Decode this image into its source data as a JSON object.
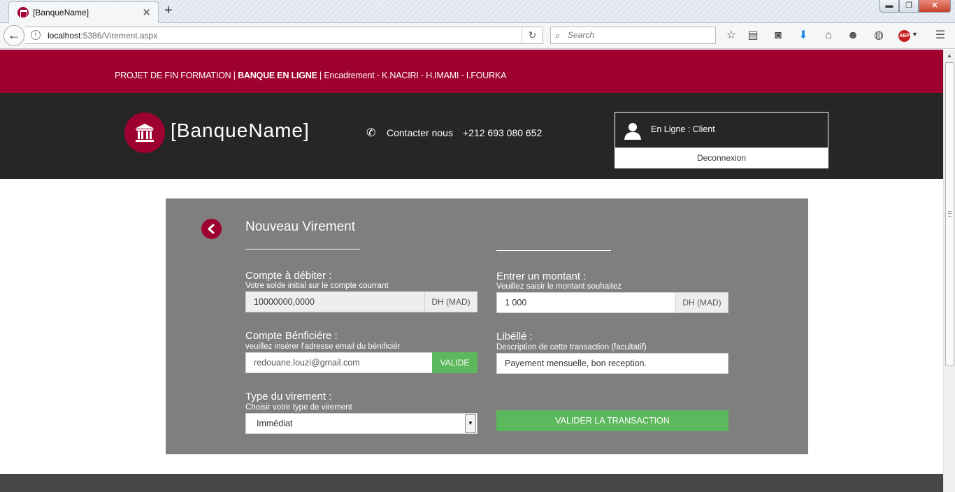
{
  "browser": {
    "tab_title": "[BanqueName]",
    "url_host": "localhost",
    "url_rest": ":5386/Virement.aspx",
    "search_placeholder": "Search",
    "abp_label": "ABP"
  },
  "topbar": {
    "prefix": "PROJET DE FIN FORMATION | ",
    "bold": "BANQUE EN LIGNE",
    "suffix": " | Encadrement - K.NACIRI - H.IMAMI - I.FOURKA"
  },
  "header": {
    "brand": "[BanqueName]",
    "contact_label": "Contacter nous",
    "contact_phone": "+212 693 080 652",
    "user_status": "En Ligne : Client",
    "logout_label": "Deconnexion"
  },
  "form": {
    "title": "Nouveau Virement",
    "debit": {
      "label": "Compte à débiter :",
      "sub": "Votre solde initial sur le compte courrant",
      "value": "10000000,0000",
      "addon": "DH (MAD)"
    },
    "amount": {
      "label": "Entrer un montant :",
      "sub": "Veuillez saisir le montant souhaitez",
      "value": "1 000",
      "addon": "DH (MAD)"
    },
    "beneficiary": {
      "label": "Compte Bénficiére :",
      "sub": "veuillez insérer l'adresse email du bénificiér",
      "value": "redouane.louzi@gmail.com",
      "button": "VALIDE"
    },
    "libelle": {
      "label": "Libéllé :",
      "sub": "Description de cette transaction (facultatif)",
      "value": "Payement mensuelle, bon reception."
    },
    "type": {
      "label": "Type du virement :",
      "sub": "Choisir votre type de virement",
      "selected": "Immédiat"
    },
    "submit_label": "VALIDER LA TRANSACTION"
  },
  "colors": {
    "brand": "#9e0030",
    "dark": "#262626",
    "panel": "#7f7f7f",
    "success": "#5cb85c"
  }
}
